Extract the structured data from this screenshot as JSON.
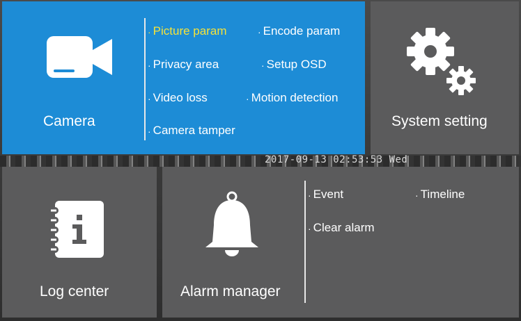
{
  "osd": {
    "timestamp": "2017-09-13 02:53:53 Wed"
  },
  "camera": {
    "label": "Camera",
    "items": [
      {
        "label": "Picture param",
        "active": true
      },
      {
        "label": "Encode param"
      },
      {
        "label": "Privacy area"
      },
      {
        "label": "Setup OSD"
      },
      {
        "label": "Video loss"
      },
      {
        "label": "Motion detection"
      },
      {
        "label": "Camera tamper"
      }
    ]
  },
  "system": {
    "label": "System setting"
  },
  "log": {
    "label": "Log center"
  },
  "alarm": {
    "label": "Alarm manager",
    "items": [
      {
        "label": "Event"
      },
      {
        "label": "Timeline"
      },
      {
        "label": "Clear alarm"
      }
    ]
  },
  "colors": {
    "camera_tile": "#1d8cd6",
    "gray_tile": "#5b5b5c",
    "active_item": "#f4e23a"
  },
  "icons": {
    "camera": "video-camera-icon",
    "system": "gears-icon",
    "log": "notebook-info-icon",
    "alarm": "bell-icon"
  }
}
